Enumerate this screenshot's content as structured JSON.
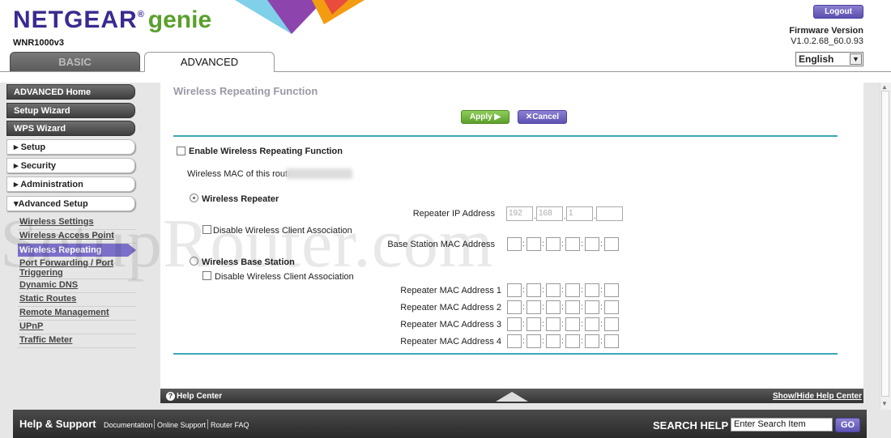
{
  "header": {
    "brand": "NETGEAR",
    "brand_suffix": "genie",
    "trademark": "®",
    "model": "WNR1000v3",
    "tabs": [
      {
        "label": "BASIC"
      },
      {
        "label": "ADVANCED"
      }
    ],
    "logout_label": "Logout",
    "firmware_label": "Firmware Version",
    "firmware_value": "V1.0.2.68_60.0.93",
    "language": "English"
  },
  "sidebar": {
    "main_items": [
      {
        "label": "ADVANCED Home"
      },
      {
        "label": "Setup Wizard"
      },
      {
        "label": "WPS Wizard"
      },
      {
        "label": "Setup"
      },
      {
        "label": "Security"
      },
      {
        "label": "Administration"
      },
      {
        "label": "Advanced Setup"
      }
    ],
    "sub_items": [
      {
        "label": "Wireless Settings"
      },
      {
        "label": "Wireless Access Point"
      },
      {
        "label": "Wireless Repeating"
      },
      {
        "label": "Port Forwarding / Port Triggering"
      },
      {
        "label": "Dynamic DNS"
      },
      {
        "label": "Static Routes"
      },
      {
        "label": "Remote Management"
      },
      {
        "label": "UPnP"
      },
      {
        "label": "Traffic Meter"
      }
    ],
    "sub_items_port_line1": "Port Forwarding / Port",
    "sub_items_port_line2": "Triggering"
  },
  "main": {
    "title": "Wireless Repeating Function",
    "apply_label": "Apply ▶",
    "cancel_label": "Cancel",
    "enable_label": "Enable Wireless Repeating Function",
    "mac_label": "Wireless MAC of this router",
    "repeater_label": "Wireless Repeater",
    "disable_assoc_label": "Disable Wireless Client Association",
    "repeater_ip_label": "Repeater IP Address",
    "repeater_ip": [
      "192",
      "168",
      "1",
      ""
    ],
    "base_mac_label": "Base Station MAC Address",
    "base_station_label": "Wireless Base Station",
    "disable_assoc_label_2": "Disable Wireless Client Association",
    "repeater_mac_labels": [
      "Repeater MAC Address 1",
      "Repeater MAC Address 2",
      "Repeater MAC Address 3",
      "Repeater MAC Address 4"
    ]
  },
  "helpbar": {
    "help_center": "Help Center",
    "toggle": "Show/Hide Help Center"
  },
  "footer": {
    "title": "Help & Support",
    "links": [
      "Documentation",
      "Online Support",
      "Router FAQ"
    ],
    "search_label": "SEARCH HELP",
    "search_value": "Enter Search Item",
    "go_label": "GO"
  },
  "watermark": "SetupRouter.com",
  "colors": {
    "accent": "#7b6fc9",
    "brand": "#3a2a8f",
    "green": "#5aa02c",
    "divider": "#3da7b8"
  }
}
